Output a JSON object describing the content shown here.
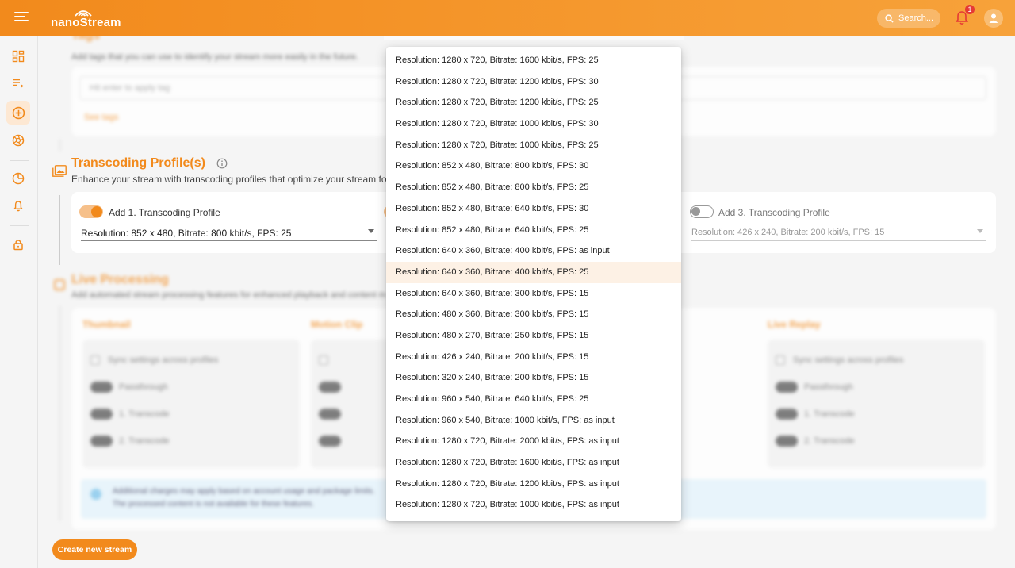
{
  "header": {
    "logo_text": "nanoStream",
    "search_label": "Search...",
    "notification_count": "1"
  },
  "sidebar": {
    "items": [
      {
        "icon": "dashboard-icon"
      },
      {
        "icon": "playlist-icon"
      },
      {
        "icon": "add-circle-icon",
        "active": true
      },
      {
        "icon": "aperture-icon"
      },
      {
        "icon": "pie-chart-icon"
      },
      {
        "icon": "bell-icon"
      },
      {
        "icon": "lock-icon"
      }
    ]
  },
  "tags": {
    "title": "Tags",
    "desc": "Add tags that you can use to identify your stream more easily in the future.",
    "placeholder": "Hit enter to apply tag",
    "see_tags": "See tags"
  },
  "transcoding": {
    "title": "Transcoding Profile(s)",
    "desc": "Enhance your stream with transcoding profiles that optimize your stream for diffe",
    "profile1": {
      "label": "Add 1. Transcoding Profile",
      "value": "Resolution: 852 x 480, Bitrate: 800 kbit/s, FPS: 25"
    },
    "profile3": {
      "label": "Add 3. Transcoding Profile",
      "value": "Resolution: 426 x 240, Bitrate: 200 kbit/s, FPS: 15"
    }
  },
  "live_processing": {
    "title": "Live Processing",
    "desc": "Add automated stream processing features for enhanced playback and content m",
    "columns": [
      "Thumbnail",
      "Motion Clip",
      "Live Replay"
    ],
    "sync_label": "Sync settings across profiles",
    "opt_passthrough": "Passthrough",
    "opt_transcode1": "1. Transcode",
    "opt_transcode2": "2. Transcode",
    "info_line1": "Additional charges may apply based on account usage and package limits.",
    "info_line2": "The processed content is not available for these features."
  },
  "create_button": "Create new stream",
  "dropdown": {
    "hover_index": 10,
    "options": [
      "Resolution: 1280 x 720, Bitrate: 1600 kbit/s, FPS: 25",
      "Resolution: 1280 x 720, Bitrate: 1200 kbit/s, FPS: 30",
      "Resolution: 1280 x 720, Bitrate: 1200 kbit/s, FPS: 25",
      "Resolution: 1280 x 720, Bitrate: 1000 kbit/s, FPS: 30",
      "Resolution: 1280 x 720, Bitrate: 1000 kbit/s, FPS: 25",
      "Resolution: 852 x 480, Bitrate: 800 kbit/s, FPS: 30",
      "Resolution: 852 x 480, Bitrate: 800 kbit/s, FPS: 25",
      "Resolution: 852 x 480, Bitrate: 640 kbit/s, FPS: 30",
      "Resolution: 852 x 480, Bitrate: 640 kbit/s, FPS: 25",
      "Resolution: 640 x 360, Bitrate: 400 kbit/s, FPS: as input",
      "Resolution: 640 x 360, Bitrate: 400 kbit/s, FPS: 25",
      "Resolution: 640 x 360, Bitrate: 300 kbit/s, FPS: 15",
      "Resolution: 480 x 360, Bitrate: 300 kbit/s, FPS: 15",
      "Resolution: 480 x 270, Bitrate: 250 kbit/s, FPS: 15",
      "Resolution: 426 x 240, Bitrate: 200 kbit/s, FPS: 15",
      "Resolution: 320 x 240, Bitrate: 200 kbit/s, FPS: 15",
      "Resolution: 960 x 540, Bitrate: 640 kbit/s, FPS: 25",
      "Resolution: 960 x 540, Bitrate: 1000 kbit/s, FPS: as input",
      "Resolution: 1280 x 720, Bitrate: 2000 kbit/s, FPS: as input",
      "Resolution: 1280 x 720, Bitrate: 1600 kbit/s, FPS: as input",
      "Resolution: 1280 x 720, Bitrate: 1200 kbit/s, FPS: as input",
      "Resolution: 1280 x 720, Bitrate: 1000 kbit/s, FPS: as input"
    ]
  },
  "colors": {
    "accent": "#f28a1c",
    "hover": "#fdf1e5",
    "info_bg": "#e3f3fc"
  }
}
